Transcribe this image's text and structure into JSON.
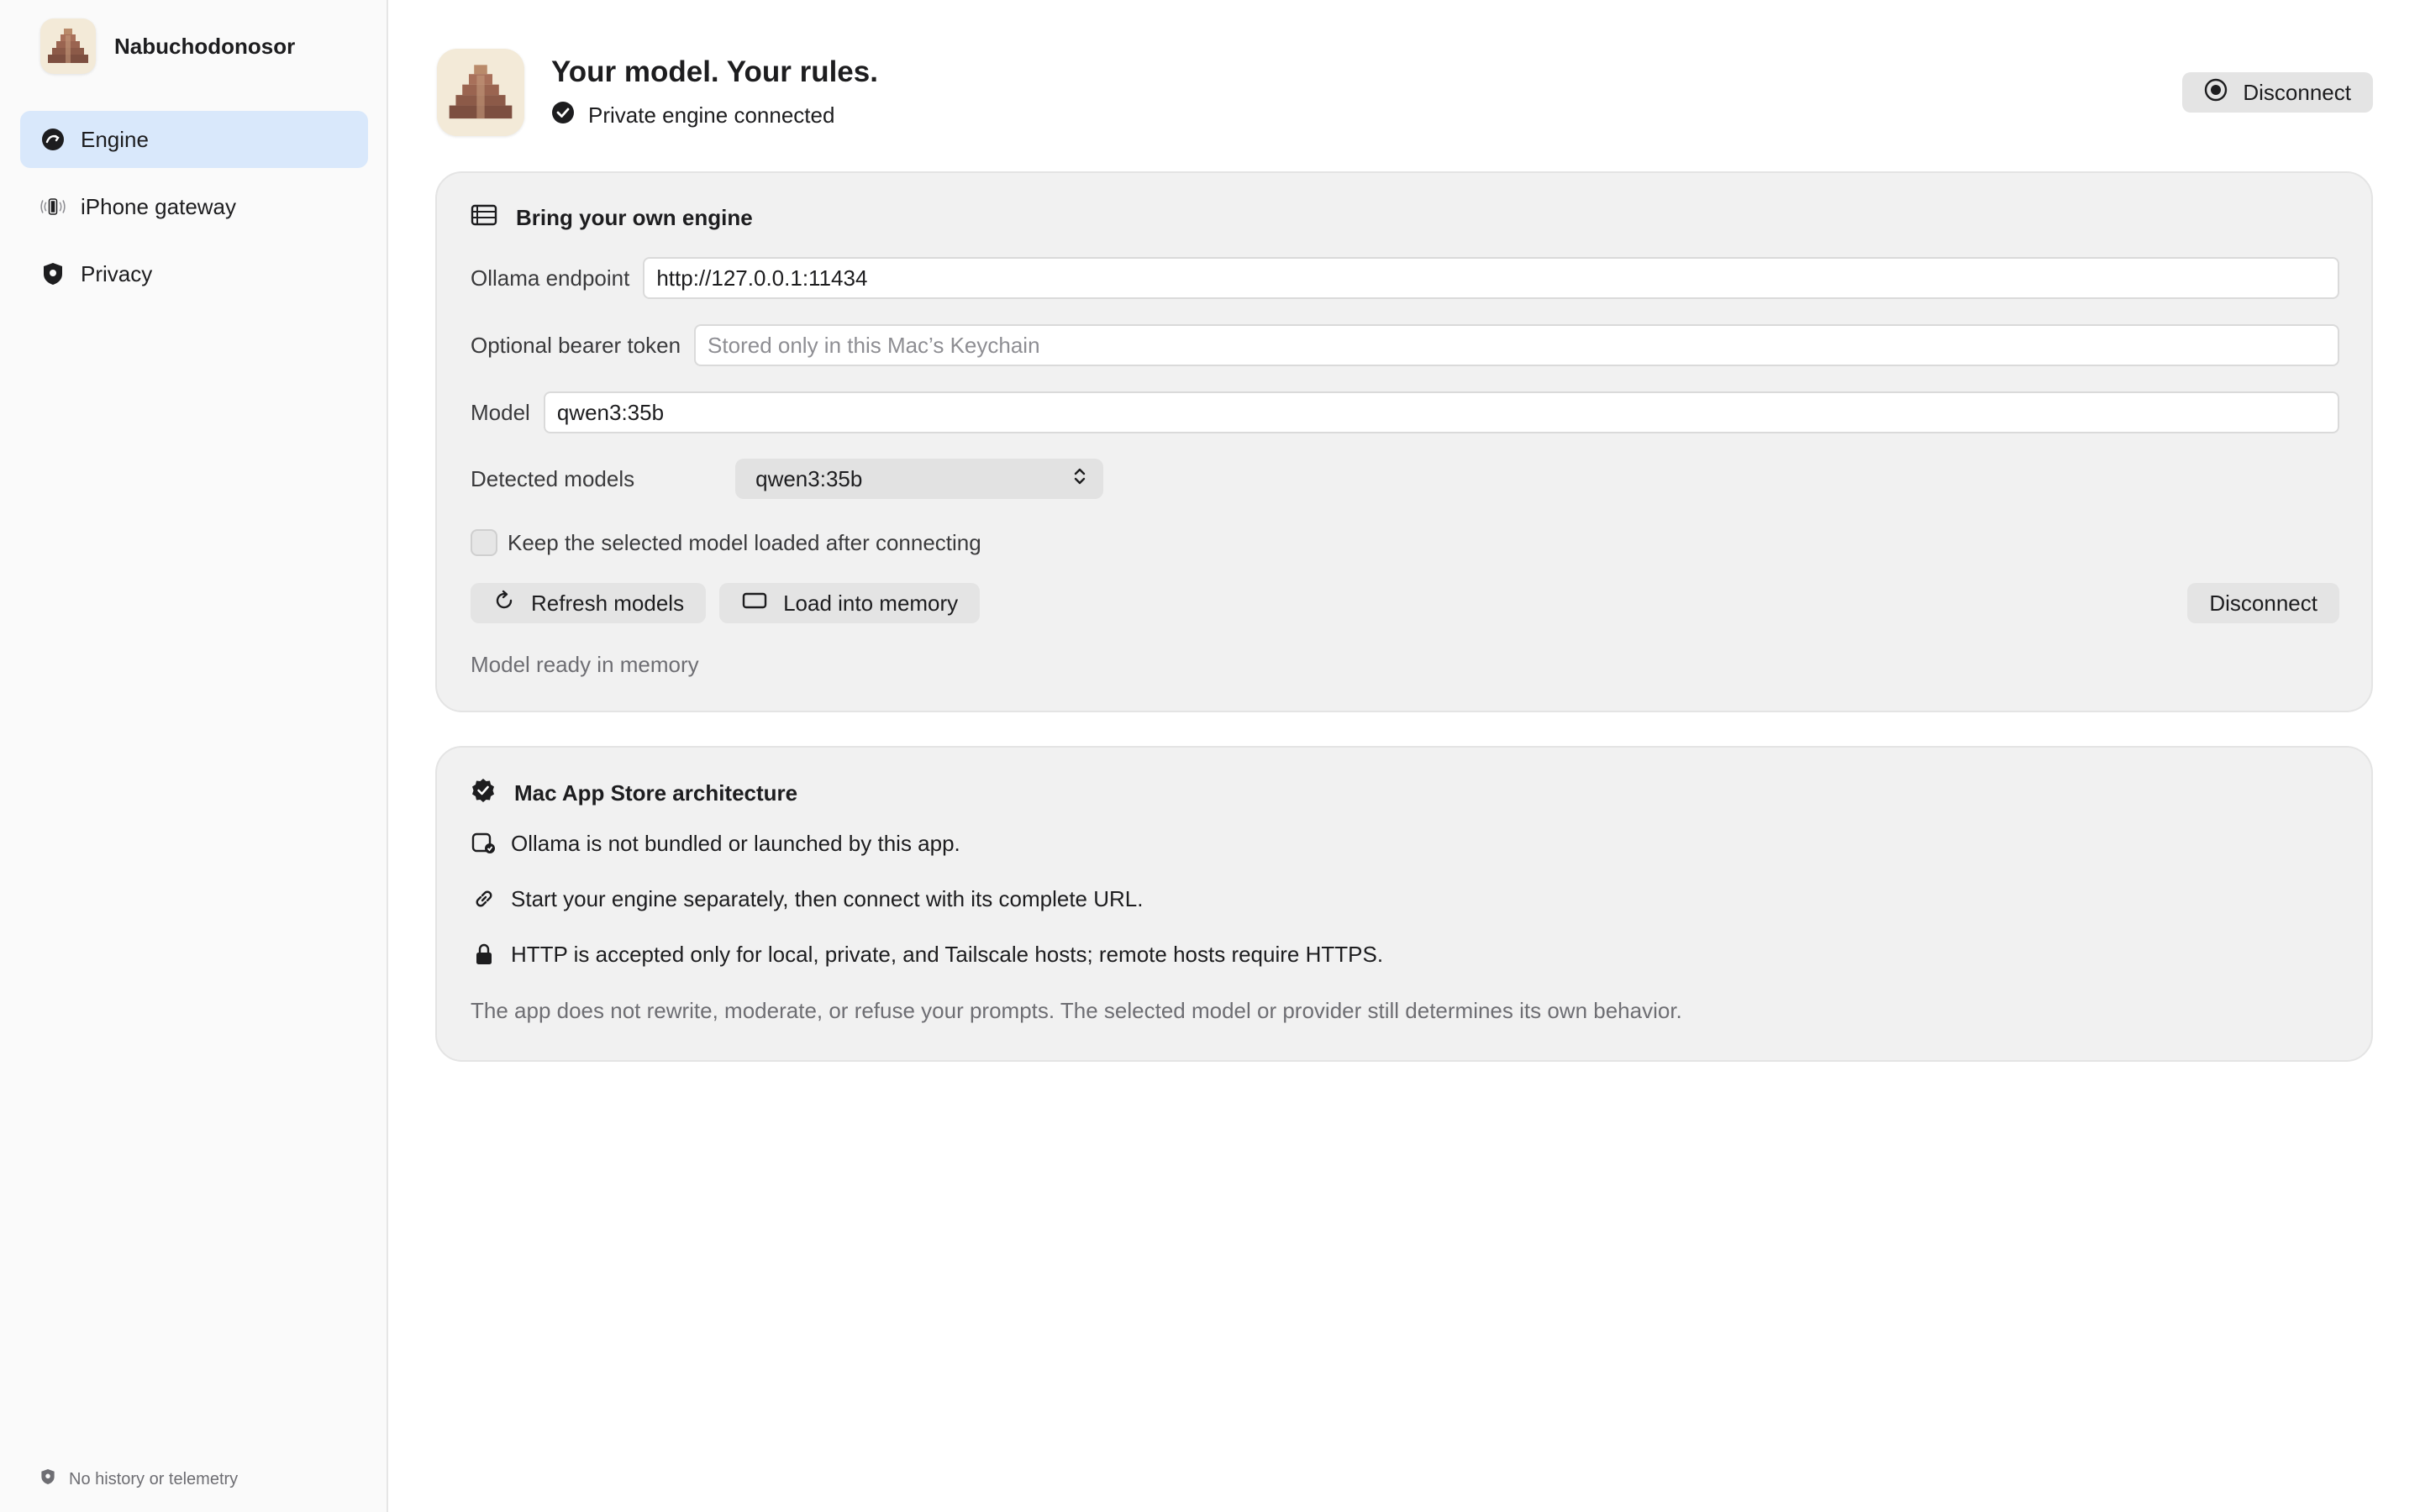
{
  "app": {
    "name": "Nabuchodonosor"
  },
  "sidebar": {
    "items": [
      {
        "label": "Engine",
        "icon": "engine-icon",
        "active": true
      },
      {
        "label": "iPhone gateway",
        "icon": "iphone-gateway-icon",
        "active": false
      },
      {
        "label": "Privacy",
        "icon": "privacy-shield-icon",
        "active": false
      }
    ],
    "footer": "No history or telemetry"
  },
  "header": {
    "title": "Your model. Your rules.",
    "status": "Private engine connected",
    "disconnect_label": "Disconnect"
  },
  "engine_card": {
    "title": "Bring your own engine",
    "endpoint_label": "Ollama endpoint",
    "endpoint_value": "http://127.0.0.1:11434",
    "token_label": "Optional bearer token",
    "token_placeholder": "Stored only in this Mac’s Keychain",
    "model_label": "Model",
    "model_value": "qwen3:35b",
    "detected_label": "Detected models",
    "detected_selected": "qwen3:35b",
    "keep_loaded_label": "Keep the selected model loaded after connecting",
    "keep_loaded_checked": false,
    "refresh_label": "Refresh models",
    "load_label": "Load into memory",
    "disconnect_label": "Disconnect",
    "status_text": "Model ready in memory"
  },
  "architecture_card": {
    "title": "Mac App Store architecture",
    "items": [
      {
        "icon": "app-not-bundled-icon",
        "text": "Ollama is not bundled or launched by this app."
      },
      {
        "icon": "link-icon",
        "text": "Start your engine separately, then connect with its complete URL."
      },
      {
        "icon": "lock-icon",
        "text": "HTTP is accepted only for local, private, and Tailscale hosts; remote hosts require HTTPS."
      }
    ],
    "note": "The app does not rewrite, moderate, or refuse your prompts. The selected model or provider still determines its own behavior."
  },
  "colors": {
    "accent_selected": "#d9e8fb",
    "card_bg": "#f1f1f1",
    "button_bg": "#e4e4e4"
  }
}
